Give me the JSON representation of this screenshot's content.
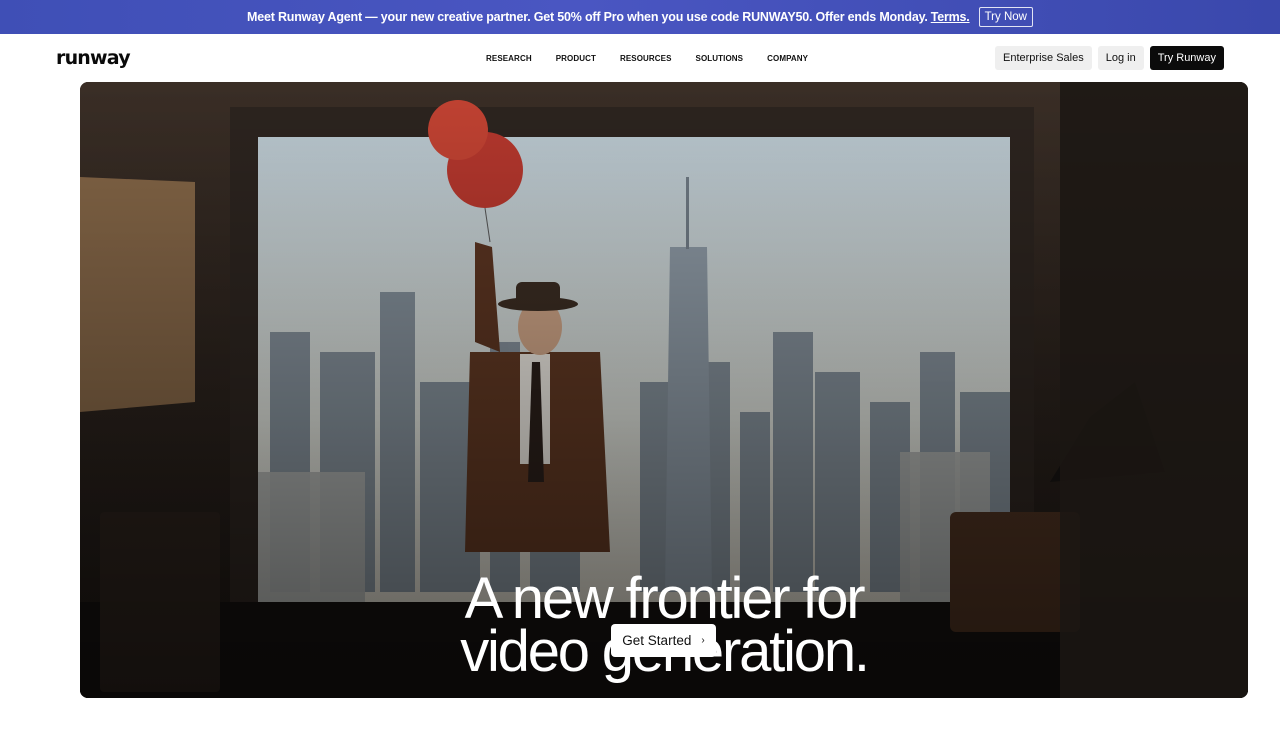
{
  "promo": {
    "message": "Meet Runway Agent — your new creative partner. Get 50% off Pro when you use code RUNWAY50. Offer ends Monday.",
    "terms_label": "Terms.",
    "cta_label": "Try Now"
  },
  "header": {
    "logo": "runway",
    "nav": [
      "RESEARCH",
      "PRODUCT",
      "RESOURCES",
      "SOLUTIONS",
      "COMPANY"
    ],
    "enterprise_label": "Enterprise Sales",
    "login_label": "Log in",
    "try_label": "Try Runway"
  },
  "hero": {
    "title_line1": "A new frontier for",
    "title_line2": "video generation.",
    "cta_label": "Get Started",
    "cta_icon": "chevron-right-icon"
  },
  "colors": {
    "banner": "#4050b8",
    "dark_button": "#0b0b0b",
    "light_button": "#efefef"
  }
}
